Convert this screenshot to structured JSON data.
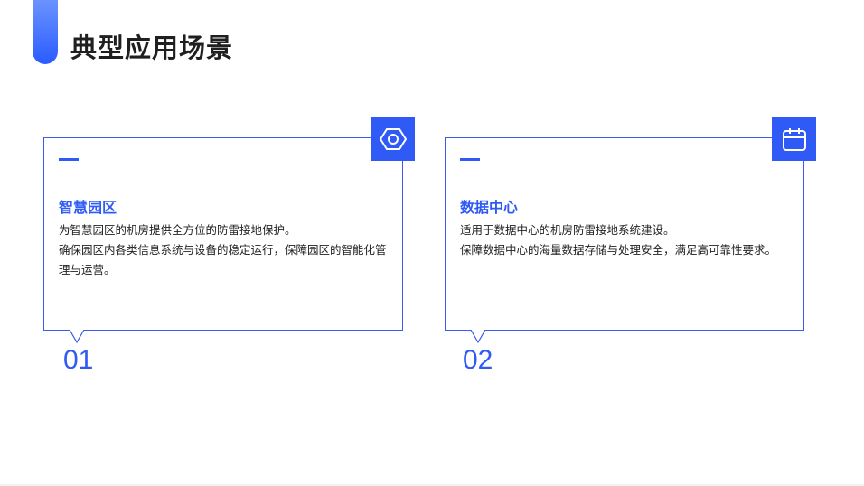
{
  "header": {
    "title": "典型应用场景"
  },
  "cards": [
    {
      "heading": "智慧园区",
      "lines": [
        "为智慧园区的机房提供全方位的防雷接地保护。",
        "确保园区内各类信息系统与设备的稳定运行，保障园区的智能化管理与运营。"
      ],
      "number": "01",
      "icon": "hexagon-nut-icon"
    },
    {
      "heading": "数据中心",
      "lines": [
        "适用于数据中心的机房防雷接地系统建设。",
        "保障数据中心的海量数据存储与处理安全，满足高可靠性要求。"
      ],
      "number": "02",
      "icon": "calendar-icon"
    }
  ],
  "colors": {
    "accent": "#2f5af5",
    "title": "#1f1f1f"
  }
}
